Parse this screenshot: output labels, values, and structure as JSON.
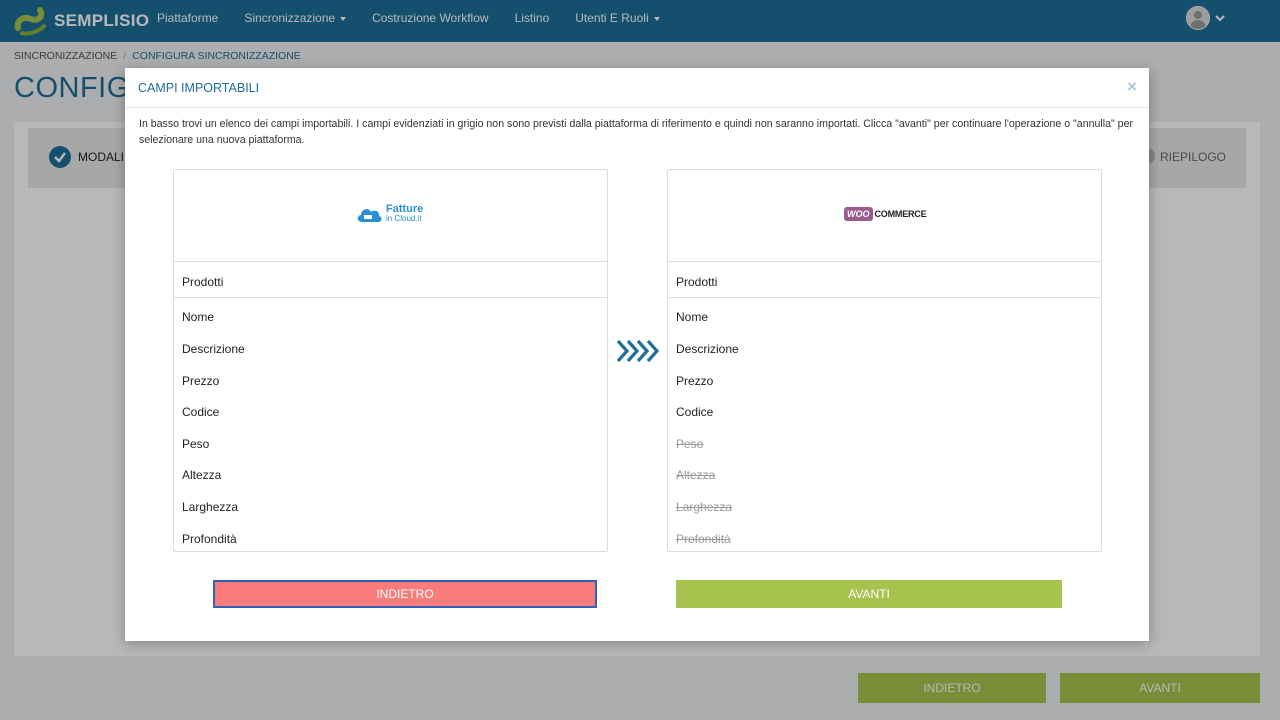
{
  "app": {
    "brand": "SEMPLISIO",
    "brand_color": "#1d6f98",
    "accent_green": "#a8c24e",
    "danger_color": "#f97b7b"
  },
  "nav": {
    "items": [
      {
        "label": "Piattaforme",
        "dropdown": false
      },
      {
        "label": "Sincronizzazione",
        "dropdown": true
      },
      {
        "label": "Costruzione Workflow",
        "dropdown": false
      },
      {
        "label": "Listino",
        "dropdown": false
      },
      {
        "label": "Utenti E Ruoli",
        "dropdown": true
      }
    ],
    "user_icon": "user-avatar-icon"
  },
  "breadcrumb": {
    "items": [
      "SINCRONIZZAZIONE",
      "CONFIGURA SINCRONIZZAZIONE"
    ]
  },
  "page": {
    "title": "CONFIGU"
  },
  "steps": {
    "first": "MODALI",
    "last": "RIEPILOGO"
  },
  "page_buttons": {
    "back": "INDIETRO",
    "next": "AVANTI"
  },
  "modal": {
    "title": "CAMPI IMPORTABILI",
    "close_icon": "×",
    "description": "In basso trovi un elenco dei campi importabili. I campi evidenziati in grigio non sono previsti dalla piattaforma di riferimento e quindi non saranno importati. Clicca \"avanti\" per continuare l'operazione o \"annulla\" per selezionare una nuova piattaforma.",
    "source": {
      "logo": {
        "line1": "Fatture",
        "line2": "in Cloud.it"
      },
      "section": "Prodotti",
      "fields": [
        {
          "label": "Nome",
          "supported": true
        },
        {
          "label": "Descrizione",
          "supported": true
        },
        {
          "label": "Prezzo",
          "supported": true
        },
        {
          "label": "Codice",
          "supported": true
        },
        {
          "label": "Peso",
          "supported": true
        },
        {
          "label": "Altezza",
          "supported": true
        },
        {
          "label": "Larghezza",
          "supported": true
        },
        {
          "label": "Profondità",
          "supported": true
        }
      ]
    },
    "target": {
      "logo": {
        "badge": "WOO",
        "text": "COMMERCE"
      },
      "section": "Prodotti",
      "fields": [
        {
          "label": "Nome",
          "supported": true
        },
        {
          "label": "Descrizione",
          "supported": true
        },
        {
          "label": "Prezzo",
          "supported": true
        },
        {
          "label": "Codice",
          "supported": true
        },
        {
          "label": "Peso",
          "supported": false
        },
        {
          "label": "Altezza",
          "supported": false
        },
        {
          "label": "Larghezza",
          "supported": false
        },
        {
          "label": "Profondità",
          "supported": false
        }
      ]
    },
    "buttons": {
      "back": "INDIETRO",
      "next": "AVANTI"
    }
  }
}
